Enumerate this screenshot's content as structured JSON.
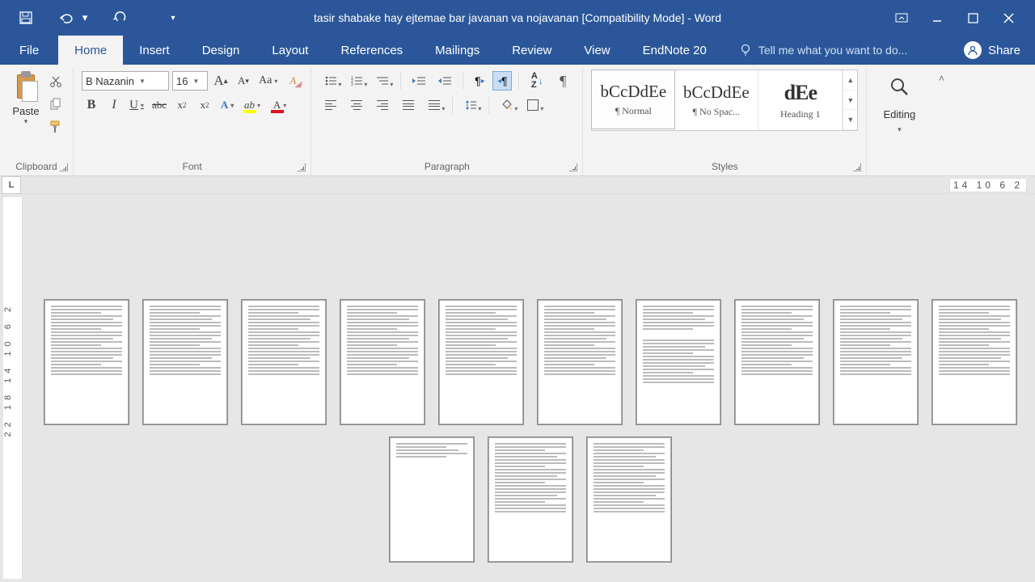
{
  "title": "tasir shabake hay ejtemae bar javanan va nojavanan [Compatibility Mode] - Word",
  "tabs": {
    "file": "File",
    "home": "Home",
    "insert": "Insert",
    "design": "Design",
    "layout": "Layout",
    "references": "References",
    "mailings": "Mailings",
    "review": "Review",
    "view": "View",
    "endnote": "EndNote 20"
  },
  "tellme": "Tell me what you want to do...",
  "share": "Share",
  "clipboard": {
    "paste": "Paste",
    "label": "Clipboard"
  },
  "font": {
    "name": "B Nazanin",
    "size": "16",
    "label": "Font",
    "increase": "A",
    "decrease": "A",
    "case": "Aa",
    "clear": "A",
    "bold": "B",
    "italic": "I",
    "underline": "U",
    "strike": "abc",
    "sub": "x",
    "sup": "x",
    "effects": "A",
    "highlight_pen": "ab",
    "color": "A"
  },
  "para": {
    "label": "Paragraph",
    "sort": "A\nZ",
    "pilcrow": "¶",
    "ltr": "¶▸",
    "rtl": "◂¶"
  },
  "styles": {
    "label": "Styles",
    "cards": [
      {
        "preview": "bCcDdEe",
        "name": "¶ Normal"
      },
      {
        "preview": "bCcDdEe",
        "name": "¶ No Spac..."
      },
      {
        "preview": "dEe",
        "name": "Heading 1"
      }
    ]
  },
  "editing": {
    "label": "Editing"
  },
  "ruler": {
    "corner": "L",
    "right": "14 10 6  2",
    "vmarks": "22 18 14 10  6  2"
  },
  "page_count": 13
}
